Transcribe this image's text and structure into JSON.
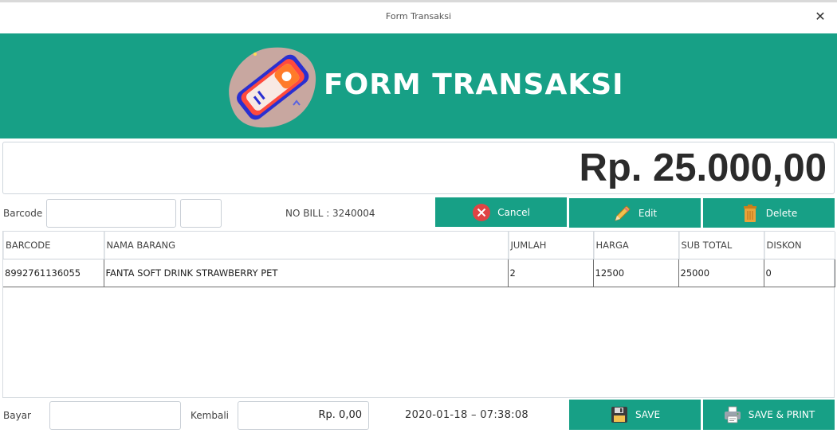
{
  "window": {
    "title": "Form Transaksi"
  },
  "banner": {
    "heading": "FORM TRANSAKSI"
  },
  "total": {
    "amount": "Rp. 25.000,00"
  },
  "entry": {
    "barcode_label": "Barcode",
    "barcode_value": "",
    "qty_value": "",
    "bill_text": "NO BILL : 3240004"
  },
  "actions": {
    "cancel_label": "Cancel",
    "edit_label": "Edit",
    "delete_label": "Delete"
  },
  "table": {
    "headers": [
      "BARCODE",
      "NAMA BARANG",
      "JUMLAH",
      "HARGA",
      "SUB TOTAL",
      "DISKON"
    ],
    "rows": [
      [
        "8992761136055",
        "FANTA SOFT DRINK STRAWBERRY PET",
        "2",
        "12500",
        "25000",
        "0"
      ]
    ]
  },
  "footer": {
    "bayar_label": "Bayar",
    "bayar_value": "",
    "kembali_label": "Kembali",
    "kembali_value": "Rp. 0,00",
    "datetime": "2020-01-18 –  07:38:08",
    "save_label": "SAVE",
    "save_print_label": "SAVE & PRINT"
  },
  "colors": {
    "accent": "#17a086",
    "cancel_icon": "#e04444",
    "delete_icon": "#e8a33a"
  },
  "icons": [
    "close-icon",
    "cancel-icon",
    "pencil-icon",
    "trash-icon",
    "floppy-disk-icon",
    "printer-icon"
  ]
}
